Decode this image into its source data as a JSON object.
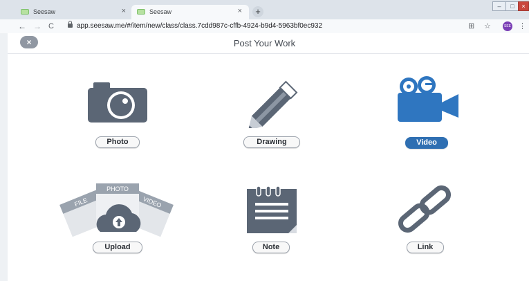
{
  "browser": {
    "tabs": [
      {
        "title": "Seesaw",
        "close": "×"
      },
      {
        "title": "Seesaw",
        "close": "×"
      }
    ],
    "new_tab": "+",
    "window_controls": {
      "minimize": "–",
      "maximize": "□",
      "close": "×"
    },
    "nav": {
      "back": "←",
      "forward": "→",
      "reload": "C"
    },
    "url": "app.seesaw.me/#/item/new/class/class.7cdd987c-cffb-4924-b9d4-5963bf0ec932",
    "toolbar_icons": {
      "translate": "⊞",
      "star": "☆",
      "menu": "⋮"
    },
    "avatar_text": "SEE"
  },
  "header": {
    "title": "Post Your Work",
    "close_icon": "×"
  },
  "options": [
    {
      "label": "Photo",
      "icon": "camera-icon"
    },
    {
      "label": "Drawing",
      "icon": "pencil-icon"
    },
    {
      "label": "Video",
      "icon": "video-camera-icon",
      "selected": true
    },
    {
      "label": "Upload",
      "icon": "cloud-upload-icon",
      "fan_labels": [
        "FILE",
        "PHOTO",
        "VIDEO"
      ]
    },
    {
      "label": "Note",
      "icon": "notepad-icon"
    },
    {
      "label": "Link",
      "icon": "chain-link-icon"
    }
  ],
  "colors": {
    "icon_gray": "#5b6675",
    "accent_blue": "#2f6fb2",
    "icon_blue": "#2f76c0"
  }
}
